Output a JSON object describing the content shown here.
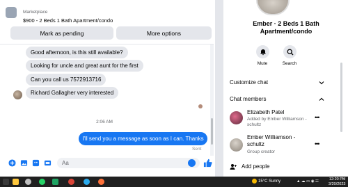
{
  "listing": {
    "kicker": "Marketplace",
    "title": "$900 - 2 Beds 1 Bath Apartment/condo",
    "mark_pending_label": "Mark as pending",
    "more_options_label": "More options"
  },
  "messages": {
    "incoming": [
      "Good afternoon, is this still available?",
      "Looking for uncle and great aunt for the first",
      "Can you call us 7572913716",
      "Richard Gallagher very interested"
    ],
    "timestamp": "2:06 AM",
    "outgoing": "I'll send you a message as soon as I can. Thanks",
    "sent_status": "Sent"
  },
  "composer": {
    "placeholder": "Aa"
  },
  "side": {
    "title": "Ember · 2 Beds 1 Bath Apartment/condo",
    "mute_label": "Mute",
    "search_label": "Search",
    "customize_label": "Customize chat",
    "members_label": "Chat members",
    "members": [
      {
        "name": "Elizabeth Patel",
        "sub": "Added by Ember Williamson - schultz"
      },
      {
        "name": "Ember Williamson - schultz",
        "sub": "Group creator"
      }
    ],
    "add_people_label": "Add people"
  },
  "taskbar": {
    "weather": "15°C  Sunny",
    "time": "12:20 PM",
    "date": "3/20/2023"
  },
  "colors": {
    "accent": "#1877f2",
    "bubble_in": "#e4e6eb",
    "taskbar": "#202020"
  }
}
